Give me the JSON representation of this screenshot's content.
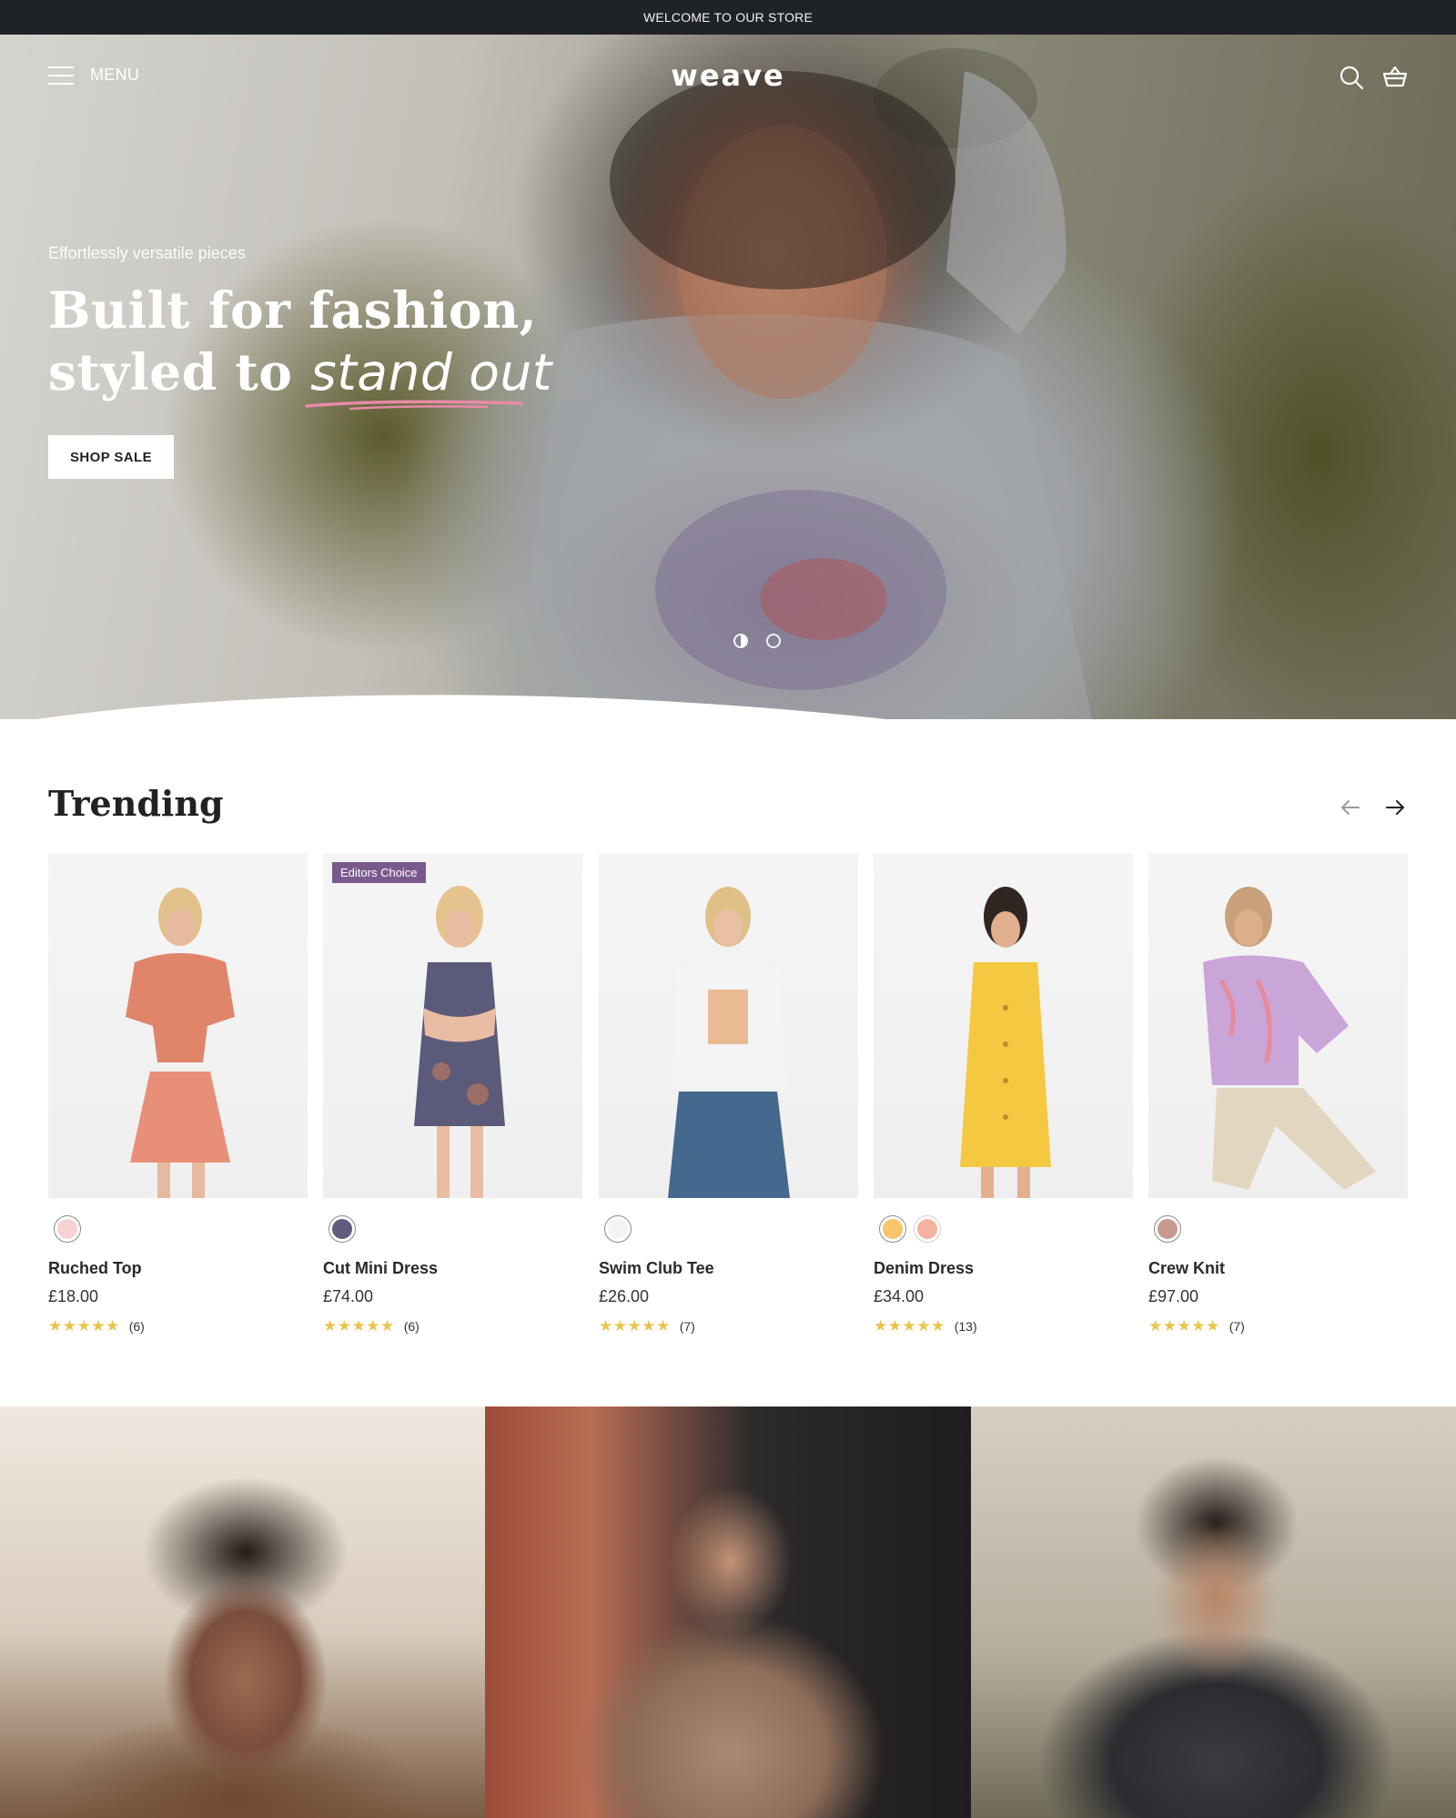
{
  "announcement": "WELCOME TO OUR STORE",
  "header": {
    "menu_label": "MENU",
    "logo": "weave",
    "icons": [
      "search-icon",
      "cart-icon",
      "menu-icon"
    ]
  },
  "hero": {
    "kicker": "Effortlessly versatile pieces",
    "title_line1": "Built for fashion,",
    "title_line2_prefix": "styled to ",
    "title_line2_accent": "stand out",
    "cta": "SHOP SALE",
    "slides": 2,
    "active_slide": 1,
    "accent_underline_color": "#e88aa8"
  },
  "trending": {
    "title": "Trending",
    "products": [
      {
        "name": "Ruched Top",
        "price": "£18.00",
        "stars": "★★★★★",
        "reviews": "(6)",
        "badge": "",
        "swatches": [
          "#f6d2d4"
        ]
      },
      {
        "name": "Cut Mini Dress",
        "price": "£74.00",
        "stars": "★★★★★",
        "reviews": "(6)",
        "badge": "Editors Choice",
        "swatches": [
          "#5f5c7e"
        ]
      },
      {
        "name": "Swim Club Tee",
        "price": "£26.00",
        "stars": "★★★★★",
        "reviews": "(7)",
        "badge": "",
        "swatches": [
          "#f4f4f4"
        ]
      },
      {
        "name": "Denim Dress",
        "price": "£34.00",
        "stars": "★★★★★",
        "reviews": "(13)",
        "badge": "",
        "swatches": [
          "#f7c56a",
          "#f4b2a0"
        ]
      },
      {
        "name": "Crew Knit",
        "price": "£97.00",
        "stars": "★★★★★",
        "reviews": "(7)",
        "badge": "",
        "swatches": [
          "#c79a90"
        ]
      }
    ]
  },
  "colors": {
    "announcement_bg": "#1f2327",
    "badge_bg": "#7a5a8c",
    "star": "#e9c44a"
  }
}
